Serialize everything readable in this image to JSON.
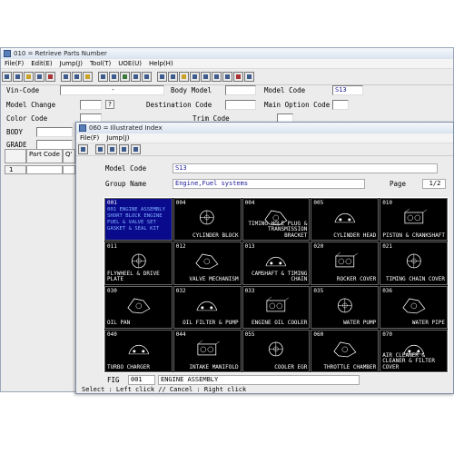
{
  "back_window": {
    "title": "010 = Retrieve Parts Number",
    "menu": [
      "File(F)",
      "Edit(E)",
      "Jump(J)",
      "Tool(T)",
      "UOE(U)",
      "Help(H)"
    ],
    "fields": {
      "vin_code_label": "Vin-Code",
      "vin_code_value": "-",
      "body_model_label": "Body Model",
      "model_code_label": "Model Code",
      "model_code_value": "S13",
      "model_change_label": "Model Change",
      "model_change_btn": "?",
      "destination_code_label": "Destination Code",
      "main_option_code_label": "Main Option Code",
      "color_code_label": "Color Code",
      "trim_code_label": "Trim Code",
      "body_label": "BODY",
      "grade_label": "GRADE"
    },
    "grid": {
      "col_part_code": "Part Code",
      "col_qty": "Q'",
      "row_1": "1"
    }
  },
  "front_window": {
    "title": "060 = Illustrated Index",
    "menu": [
      "File(F)",
      "Jump(J)"
    ],
    "model_code_label": "Model Code",
    "model_code_value": "S13",
    "group_name_label": "Group Name",
    "group_name_value": "Engine,Fuel systems",
    "page_label": "Page",
    "page_value": "1/2",
    "fig_label": "FIG",
    "fig_code": "001",
    "fig_name": "ENGINE ASSEMBLY",
    "status_text": "Select : Left click // Cancel : Right click",
    "selected_cell_text": "001 ENGINE ASSEMBLY SHORT BLOCK ENGINE FUEL & VALVE SET GASKET & SEAL KIT",
    "cells": [
      {
        "code": "001",
        "name": "",
        "icon": "engine-assembly-icon"
      },
      {
        "code": "004",
        "name": "CYLINDER BLOCK",
        "icon": "cylinder-block-icon"
      },
      {
        "code": "004",
        "name": "TIMING HOLE PLUG & TRANSMISSION BRACKET",
        "icon": "timing-hole-plug-icon"
      },
      {
        "code": "005",
        "name": "CYLINDER HEAD",
        "icon": "cylinder-head-icon"
      },
      {
        "code": "010",
        "name": "PISTON & CRANKSHAFT",
        "icon": "piston-crankshaft-icon"
      },
      {
        "code": "011",
        "name": "FLYWHEEL & DRIVE PLATE",
        "icon": "flywheel-icon"
      },
      {
        "code": "012",
        "name": "VALVE MECHANISM",
        "icon": "valve-mechanism-icon"
      },
      {
        "code": "013",
        "name": "CAMSHAFT & TIMING CHAIN",
        "icon": "camshaft-icon"
      },
      {
        "code": "020",
        "name": "ROCKER COVER",
        "icon": "rocker-cover-icon"
      },
      {
        "code": "021",
        "name": "TIMING CHAIN COVER",
        "icon": "timing-chain-cover-icon"
      },
      {
        "code": "030",
        "name": "OIL PAN",
        "icon": "oil-pan-icon"
      },
      {
        "code": "032",
        "name": "OIL FILTER & PUMP",
        "icon": "oil-filter-icon"
      },
      {
        "code": "033",
        "name": "ENGINE OIL COOLER",
        "icon": "oil-cooler-icon"
      },
      {
        "code": "035",
        "name": "WATER PUMP",
        "icon": "water-pump-icon"
      },
      {
        "code": "036",
        "name": "WATER PIPE",
        "icon": "water-pipe-icon"
      },
      {
        "code": "040",
        "name": "TURBO CHARGER",
        "icon": "turbo-charger-icon"
      },
      {
        "code": "044",
        "name": "INTAKE MANIFOLD",
        "icon": "intake-manifold-icon"
      },
      {
        "code": "055",
        "name": "COOLER EGR",
        "icon": "cooler-egr-icon"
      },
      {
        "code": "060",
        "name": "THROTTLE CHAMBER",
        "icon": "throttle-chamber-icon"
      },
      {
        "code": "070",
        "name": "AIR CLEANER & CLEANER & FILTER COVER",
        "icon": "air-cleaner-icon"
      }
    ]
  },
  "colors": {
    "grid_bg": "#000000",
    "selected_bg": "#0a0a8c",
    "input_text": "#1a1a9a"
  }
}
